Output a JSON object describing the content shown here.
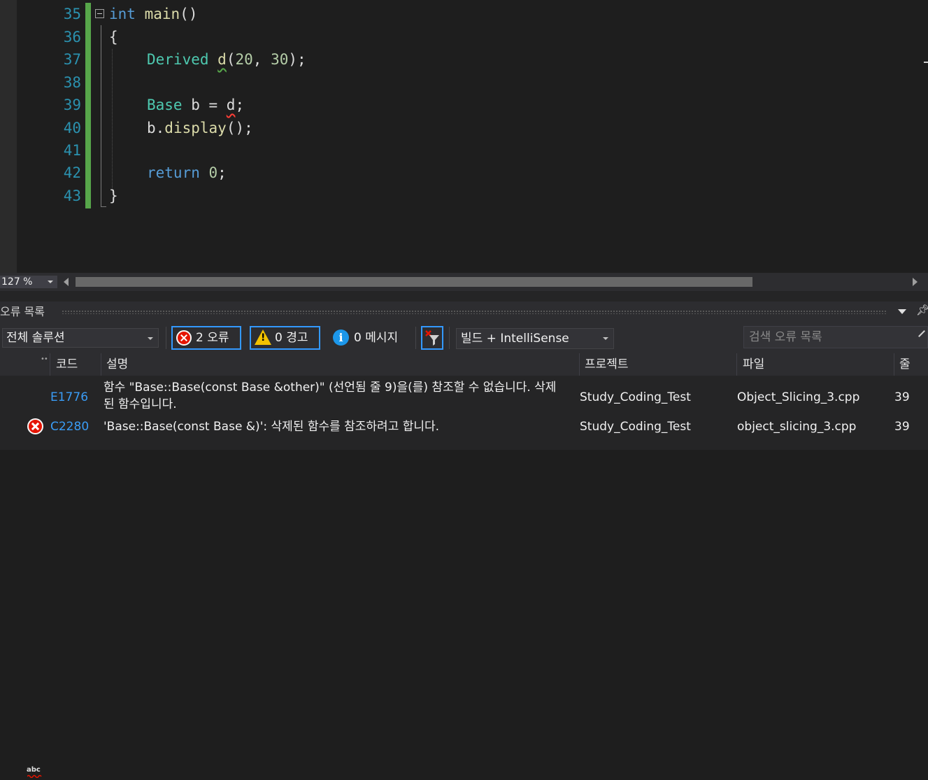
{
  "editor": {
    "line_numbers": [
      "35",
      "36",
      "37",
      "38",
      "39",
      "40",
      "41",
      "42",
      "43"
    ],
    "lines": {
      "l35_kw": "int",
      "l35_fn": "main",
      "l35_rest": "()",
      "l36": "{",
      "l37_type": "Derived",
      "l37_sp": " ",
      "l37_var": "d",
      "l37_p1": "(",
      "l37_n1": "20",
      "l37_c": ", ",
      "l37_n2": "30",
      "l37_p2": ");",
      "l39_type": "Base",
      "l39_mid": " b = ",
      "l39_var": "d",
      "l39_end": ";",
      "l40_obj": "b.",
      "l40_fn": "display",
      "l40_end": "();",
      "l42_kw": "return",
      "l42_sp": " ",
      "l42_num": "0",
      "l42_end": ";",
      "l43": "}"
    }
  },
  "zoom": {
    "label": "127 %"
  },
  "panel": {
    "title": "오류 목록",
    "scope": "전체 솔루션",
    "errors_btn": "2 오류",
    "warnings_btn": "0 경고",
    "messages_btn": "0 메시지",
    "build_filter": "빌드 + IntelliSense",
    "search_placeholder": "검색 오류 목록",
    "columns": {
      "code": "코드",
      "description": "설명",
      "project": "프로젝트",
      "file": "파일",
      "line": "줄"
    },
    "rows": [
      {
        "icon": "intellisense-squiggle-icon",
        "code": "E1776",
        "description_1": "함수 \"Base::Base(const Base &other)\" (선언됨 줄 9)을(를) 참조할 수 없습니다. 삭제",
        "description_2": "된 함수입니다.",
        "project": "Study_Coding_Test",
        "file": "Object_Slicing_3.cpp",
        "line": "39"
      },
      {
        "icon": "error-icon",
        "code": "C2280",
        "description_1": "'Base::Base(const Base &)': 삭제된 함수를 참조하려고 합니다.",
        "project": "Study_Coding_Test",
        "file": "object_slicing_3.cpp",
        "line": "39"
      }
    ]
  },
  "colors": {
    "accent": "#3399ff",
    "error": "#e51400",
    "warning": "#f2c200",
    "info": "#1c97ea",
    "change_bar": "#57a64a"
  }
}
